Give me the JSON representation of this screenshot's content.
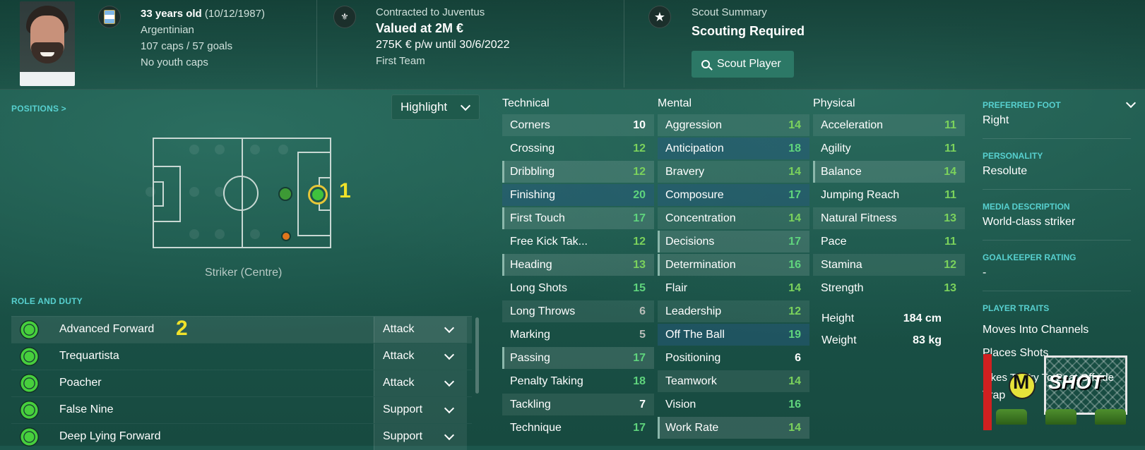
{
  "header": {
    "age": "33 years old",
    "birthdate": "(10/12/1987)",
    "nationality": "Argentinian",
    "caps": "107 caps / 57 goals",
    "youth_caps": "No youth caps",
    "contract_label": "Contracted to Juventus",
    "value": "Valued at 2M €",
    "wage": "275K € p/w until 30/6/2022",
    "squad": "First Team",
    "scout_summary_label": "Scout Summary",
    "scout_summary_value": "Scouting Required",
    "scout_button": "Scout Player"
  },
  "positions": {
    "label": "POSITIONS >",
    "highlight": "Highlight",
    "position_name": "Striker (Centre)",
    "annotation_1": "1",
    "annotation_2": "2"
  },
  "roles": {
    "label": "ROLE AND DUTY",
    "items": [
      {
        "name": "Advanced Forward",
        "duty": "Attack"
      },
      {
        "name": "Trequartista",
        "duty": "Attack"
      },
      {
        "name": "Poacher",
        "duty": "Attack"
      },
      {
        "name": "False Nine",
        "duty": "Support"
      },
      {
        "name": "Deep Lying Forward",
        "duty": "Support"
      }
    ]
  },
  "attributes": {
    "technical_label": "Technical",
    "mental_label": "Mental",
    "physical_label": "Physical",
    "technical": [
      {
        "name": "Corners",
        "value": "10"
      },
      {
        "name": "Crossing",
        "value": "12"
      },
      {
        "name": "Dribbling",
        "value": "12"
      },
      {
        "name": "Finishing",
        "value": "20"
      },
      {
        "name": "First Touch",
        "value": "17"
      },
      {
        "name": "Free Kick Tak...",
        "value": "12"
      },
      {
        "name": "Heading",
        "value": "13"
      },
      {
        "name": "Long Shots",
        "value": "15"
      },
      {
        "name": "Long Throws",
        "value": "6"
      },
      {
        "name": "Marking",
        "value": "5"
      },
      {
        "name": "Passing",
        "value": "17"
      },
      {
        "name": "Penalty Taking",
        "value": "18"
      },
      {
        "name": "Tackling",
        "value": "7"
      },
      {
        "name": "Technique",
        "value": "17"
      }
    ],
    "mental": [
      {
        "name": "Aggression",
        "value": "14"
      },
      {
        "name": "Anticipation",
        "value": "18"
      },
      {
        "name": "Bravery",
        "value": "14"
      },
      {
        "name": "Composure",
        "value": "17"
      },
      {
        "name": "Concentration",
        "value": "14"
      },
      {
        "name": "Decisions",
        "value": "17"
      },
      {
        "name": "Determination",
        "value": "16"
      },
      {
        "name": "Flair",
        "value": "14"
      },
      {
        "name": "Leadership",
        "value": "12"
      },
      {
        "name": "Off The Ball",
        "value": "19"
      },
      {
        "name": "Positioning",
        "value": "6"
      },
      {
        "name": "Teamwork",
        "value": "14"
      },
      {
        "name": "Vision",
        "value": "16"
      },
      {
        "name": "Work Rate",
        "value": "14"
      }
    ],
    "physical": [
      {
        "name": "Acceleration",
        "value": "11"
      },
      {
        "name": "Agility",
        "value": "11"
      },
      {
        "name": "Balance",
        "value": "14"
      },
      {
        "name": "Jumping Reach",
        "value": "11"
      },
      {
        "name": "Natural Fitness",
        "value": "13"
      },
      {
        "name": "Pace",
        "value": "11"
      },
      {
        "name": "Stamina",
        "value": "12"
      },
      {
        "name": "Strength",
        "value": "13"
      }
    ],
    "height_label": "Height",
    "height": "184 cm",
    "weight_label": "Weight",
    "weight": "83 kg"
  },
  "side": {
    "preferred_foot_label": "PREFERRED FOOT",
    "preferred_foot": "Right",
    "personality_label": "PERSONALITY",
    "personality": "Resolute",
    "media_label": "MEDIA DESCRIPTION",
    "media": "World-class striker",
    "gk_label": "GOALKEEPER RATING",
    "gk": "-",
    "traits_label": "PLAYER TRAITS",
    "traits": [
      "Moves Into Channels",
      "Places Shots",
      "Likes To Try To Beat Offside",
      "Trap"
    ]
  },
  "logo": {
    "text_a": "M",
    "text_b": "SHOT"
  },
  "colors": {
    "accent": "#57d0cf",
    "good": "#7bd25c",
    "great": "#5fd47d",
    "annotation": "#f0e22a",
    "background": "#1c564c"
  }
}
